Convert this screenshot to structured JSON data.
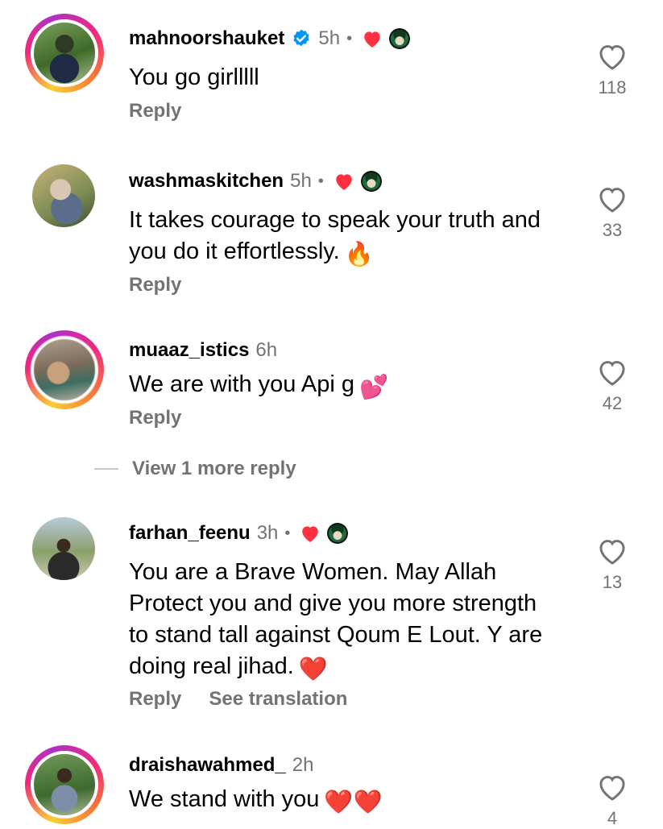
{
  "comments": [
    {
      "username": "mahnoorshauket",
      "verified": true,
      "time": "5h",
      "creator_liked": true,
      "text": "You go girlllll",
      "emoji": "",
      "reply_label": "Reply",
      "likes": "118"
    },
    {
      "username": "washmaskitchen",
      "verified": false,
      "time": "5h",
      "creator_liked": true,
      "text": "It takes courage to speak your truth and you do it effortlessly.",
      "emoji": "🔥",
      "reply_label": "Reply",
      "likes": "33"
    },
    {
      "username": "muaaz_istics",
      "verified": false,
      "time": "6h",
      "creator_liked": false,
      "text": "We are with you Api g",
      "emoji": "💕",
      "reply_label": "Reply",
      "likes": "42"
    },
    {
      "username": "farhan_feenu",
      "verified": false,
      "time": "3h",
      "creator_liked": true,
      "text": "You are a Brave Women. May Allah Protect you and give you more strength to stand tall against Qoum E Lout. Y are doing real jihad.",
      "emoji": "❤️",
      "reply_label": "Reply",
      "translate_label": "See translation",
      "likes": "13"
    },
    {
      "username": "draishawahmed_",
      "verified": false,
      "time": "2h",
      "creator_liked": false,
      "text": "We stand with you",
      "emoji": "❤️❤️",
      "reply_label": "",
      "likes": "4"
    }
  ],
  "view_more_replies": "View 1 more reply",
  "separator_dot": "•",
  "colors": {
    "secondary_text": "#737373",
    "heart_red": "#ff3040",
    "verified_blue": "#0095f6"
  },
  "icons": {
    "like": "heart-outline-icon",
    "creator_like": "heart-filled-icon",
    "verified": "verified-badge-icon"
  }
}
